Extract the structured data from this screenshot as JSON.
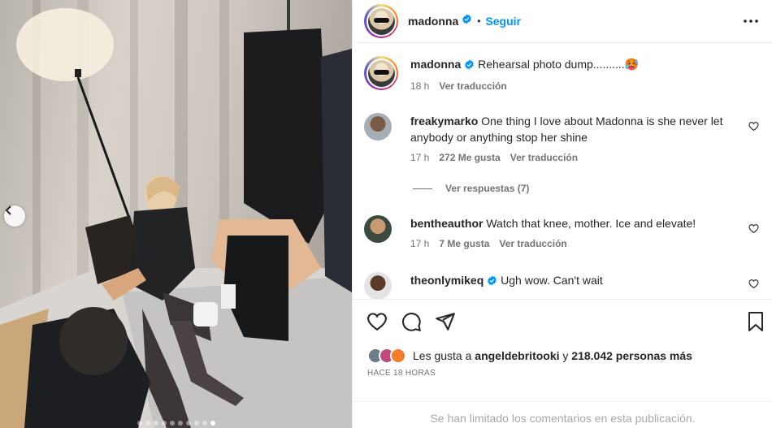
{
  "header": {
    "username": "madonna",
    "separator": "•",
    "follow_label": "Seguir"
  },
  "caption": {
    "username": "madonna",
    "text": "Rehearsal photo dump..........🥵",
    "time": "18 h",
    "translate_label": "Ver traducción"
  },
  "comments": [
    {
      "username": "freakymarko",
      "text": "One thing I love about Madonna is she never let anybody or anything stop her shine",
      "time": "17 h",
      "likes": "272 Me gusta",
      "translate_label": "Ver traducción",
      "replies_label": "Ver respuestas (7)"
    },
    {
      "username": "bentheauthor",
      "text": "Watch that knee, mother. Ice and elevate!",
      "time": "17 h",
      "likes": "7 Me gusta",
      "translate_label": "Ver traducción"
    },
    {
      "username": "theonlymikeq",
      "text": "Ugh wow. Can't wait"
    }
  ],
  "likes": {
    "prefix": "Les gusta a",
    "user": "angeldebritooki",
    "connector": "y",
    "count": "218.042 personas más"
  },
  "posted_ago": "HACE 18 HORAS",
  "comments_limited": "Se han limitado los comentarios en esta publicación.",
  "carousel": {
    "total": 10,
    "active": 9
  },
  "icons": {
    "like": "heart-icon",
    "comment": "comment-icon",
    "share": "share-icon",
    "save": "bookmark-icon",
    "more": "more-icon",
    "verified": "verified-icon",
    "prev": "chevron-left-icon"
  },
  "colors": {
    "link": "#0095f6",
    "verified": "#0095f6",
    "muted": "#737373"
  }
}
